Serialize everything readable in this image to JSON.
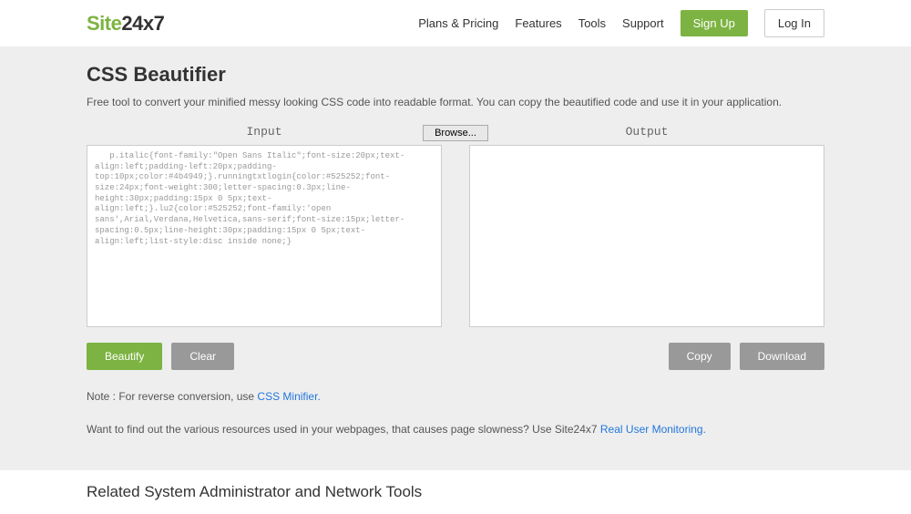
{
  "header": {
    "logo_green": "Site",
    "logo_dark": "24x7",
    "nav": {
      "plans": "Plans & Pricing",
      "features": "Features",
      "tools": "Tools",
      "support": "Support",
      "signup": "Sign Up",
      "login": "Log In"
    }
  },
  "main": {
    "title": "CSS Beautifier",
    "description": "Free tool to convert your minified messy looking CSS code into readable format. You can copy the beautified code and use it in your application.",
    "input_label": "Input",
    "output_label": "Output",
    "browse_label": "Browse...",
    "input_value": "   p.italic{font-family:\"Open Sans Italic\";font-size:20px;text-align:left;padding-left:20px;padding-top:10px;color:#4b4949;}.runningtxtlogin{color:#525252;font-size:24px;font-weight:300;letter-spacing:0.3px;line-height:30px;padding:15px 0 5px;text-align:left;}.lu2{color:#525252;font-family:'open sans',Arial,Verdana,Helvetica,sans-serif;font-size:15px;letter-spacing:0.5px;line-height:30px;padding:15px 0 5px;text-align:left;list-style:disc inside none;}",
    "buttons": {
      "beautify": "Beautify",
      "clear": "Clear",
      "copy": "Copy",
      "download": "Download"
    },
    "note_prefix": "Note : For reverse conversion, use ",
    "note_link": "CSS Minifier.",
    "info_prefix": "Want to find out the various resources used in your webpages, that causes page slowness? Use Site24x7 ",
    "info_link": "Real User Monitoring."
  },
  "related": {
    "title": "Related System Administrator and Network Tools"
  }
}
